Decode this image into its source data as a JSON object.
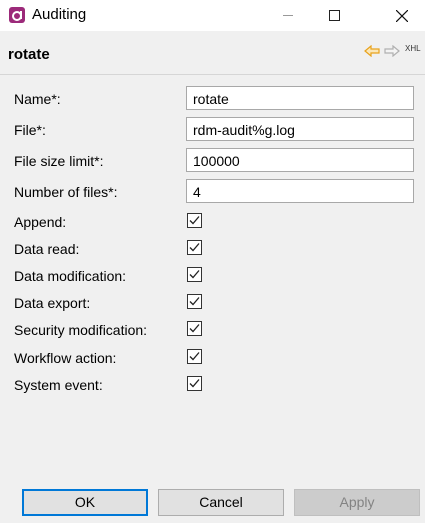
{
  "window": {
    "title": "Auditing",
    "minimize_icon": "minimize-icon",
    "maximize_icon": "maximize-icon",
    "close_icon": "close-icon"
  },
  "header": {
    "title": "rotate",
    "xhl_label": "XHL",
    "colors": {
      "arrow": "#e8a21c"
    }
  },
  "fields": {
    "name": {
      "label": "Name*:",
      "value": "rotate"
    },
    "file": {
      "label": "File*:",
      "value": "rdm-audit%g.log"
    },
    "file_size_limit": {
      "label": "File size limit*:",
      "value": "100000"
    },
    "number_of_files": {
      "label": "Number of files*:",
      "value": "4"
    }
  },
  "checkboxes": {
    "append": {
      "label": "Append:",
      "checked": true
    },
    "data_read": {
      "label": "Data read:",
      "checked": true
    },
    "data_modification": {
      "label": "Data modification:",
      "checked": true
    },
    "data_export": {
      "label": "Data export:",
      "checked": true
    },
    "security_modification": {
      "label": "Security modification:",
      "checked": true
    },
    "workflow_action": {
      "label": "Workflow action:",
      "checked": true
    },
    "system_event": {
      "label": "System event:",
      "checked": true
    }
  },
  "buttons": {
    "ok": "OK",
    "cancel": "Cancel",
    "apply": "Apply"
  }
}
